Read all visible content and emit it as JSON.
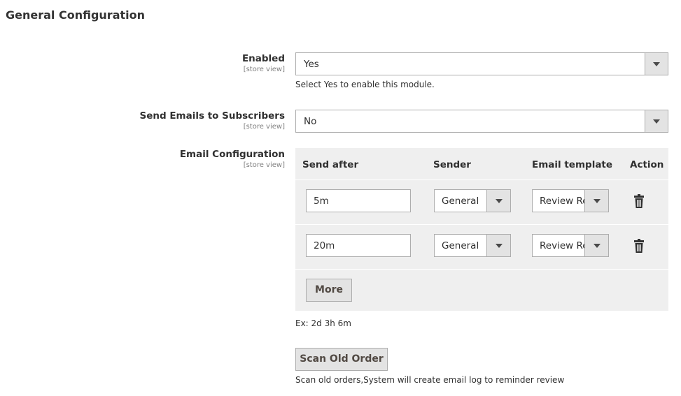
{
  "section": {
    "title": "General Configuration"
  },
  "enabled": {
    "label": "Enabled",
    "scope": "[store view]",
    "value": "Yes",
    "note": "Select Yes to enable this module."
  },
  "send_emails": {
    "label": "Send Emails to Subscribers",
    "scope": "[store view]",
    "value": "No"
  },
  "email_config": {
    "label": "Email Configuration",
    "scope": "[store view]",
    "columns": [
      "Send after",
      "Sender",
      "Email template",
      "Action"
    ],
    "rows": [
      {
        "send_after": "5m",
        "sender": "General",
        "template": "Review Reminder"
      },
      {
        "send_after": "20m",
        "sender": "General",
        "template": "Review Reminder"
      }
    ],
    "more_label": "More",
    "note": "Ex: 2d 3h 6m"
  },
  "scan": {
    "button_label": "Scan Old Order",
    "note": "Scan old orders,System will create email log to reminder review"
  }
}
